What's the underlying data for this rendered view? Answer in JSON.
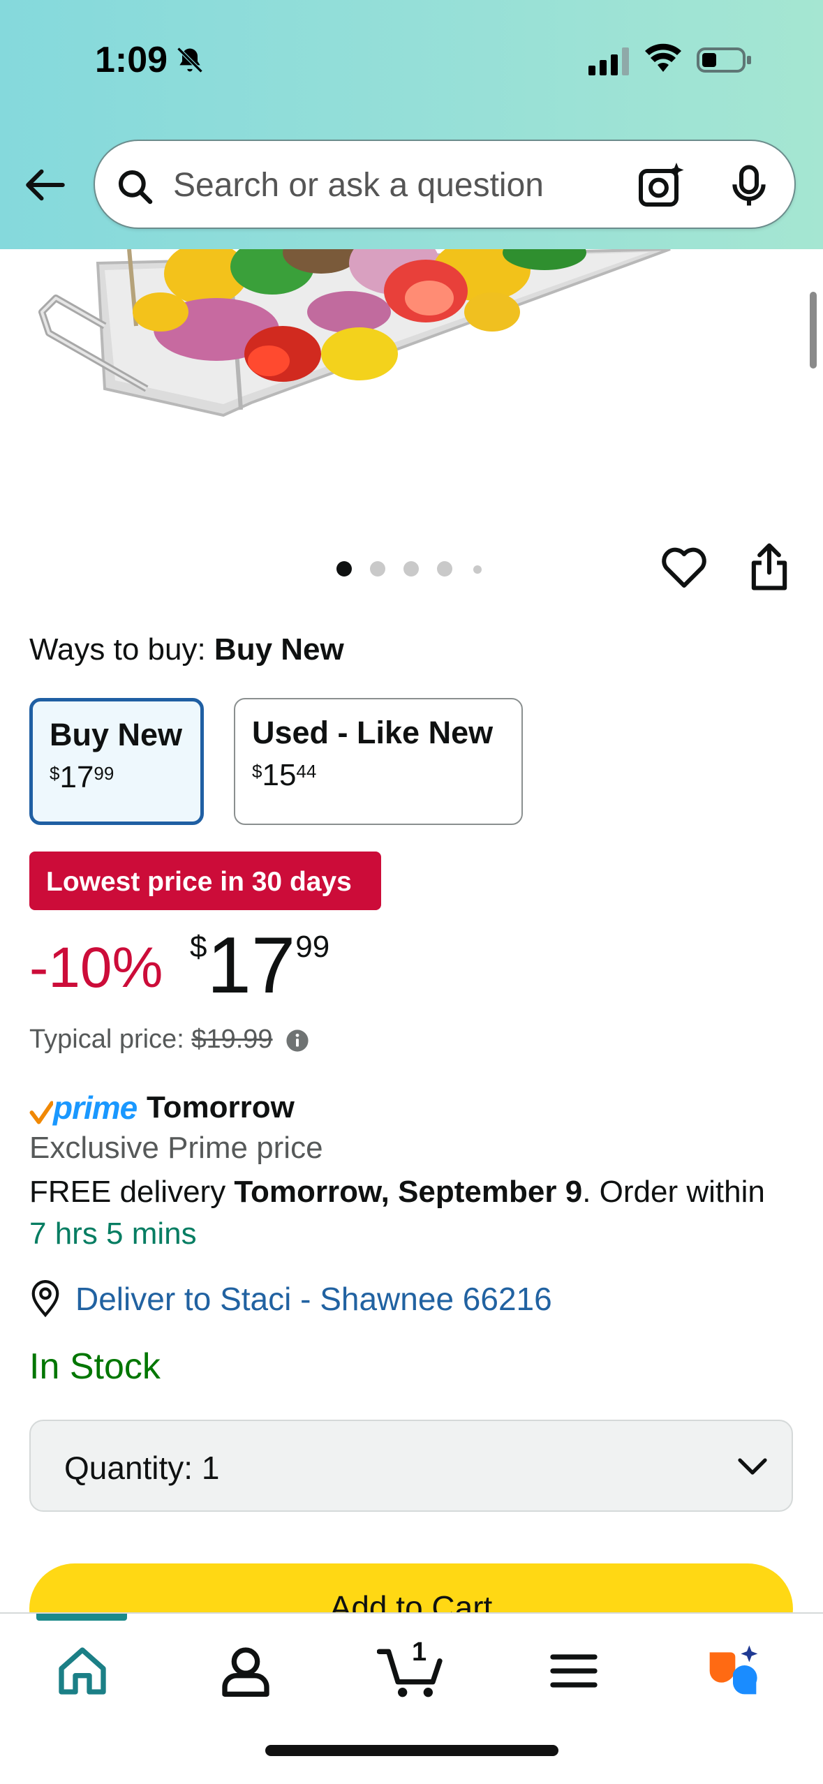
{
  "status_bar": {
    "time": "1:09"
  },
  "search": {
    "placeholder": "Search or ask a question"
  },
  "buying_options": {
    "label_prefix": "Ways to buy:",
    "selected": "Buy New",
    "options": [
      {
        "title": "Buy New",
        "currency": "$",
        "whole": "17",
        "fraction": "99"
      },
      {
        "title": "Used - Like New",
        "currency": "$",
        "whole": "15",
        "fraction": "44"
      }
    ]
  },
  "deal": {
    "badge": "Lowest price in 30 days",
    "discount": "-10%",
    "currency": "$",
    "whole": "17",
    "fraction": "99",
    "typical_label": "Typical price:",
    "typical_price": "$19.99"
  },
  "delivery": {
    "prime_word": "prime",
    "prime_label": "Tomorrow",
    "exclusive": "Exclusive Prime price",
    "free_prefix": "FREE delivery",
    "date": "Tomorrow, September 9",
    "order_prefix": ". Order within",
    "countdown": "7 hrs 5 mins",
    "location": "Deliver to Staci - Shawnee 66216"
  },
  "stock": "In Stock",
  "quantity": {
    "label": "Quantity:",
    "value": "1"
  },
  "add_to_cart": "Add to Cart",
  "cart": {
    "count": "1"
  },
  "colors": {
    "header_gradient_start": "#85d9dc",
    "header_gradient_end": "#a5e6d2",
    "deal_red": "#cc0c39",
    "link_blue": "#2162a1",
    "stock_green": "#007600",
    "add_to_cart_yellow": "#ffd814",
    "prime_blue": "#1a98ff"
  }
}
